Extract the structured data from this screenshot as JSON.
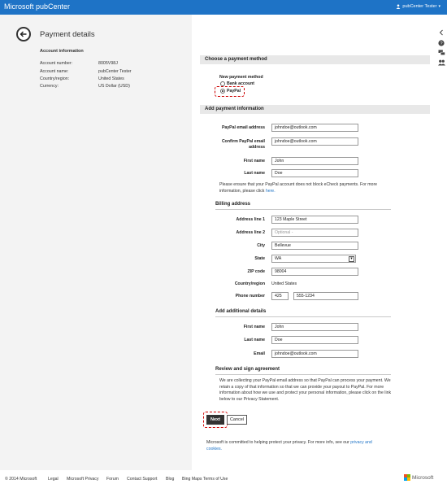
{
  "app": {
    "title": "Microsoft pubCenter",
    "user": "pubCenter Tester"
  },
  "page": {
    "title": "Payment details"
  },
  "account": {
    "heading": "Account information",
    "rows": [
      {
        "label": "Account number:",
        "value": "8005V98J"
      },
      {
        "label": "Account name:",
        "value": "pubCenter Tester"
      },
      {
        "label": "Country/region:",
        "value": "United States"
      },
      {
        "label": "Currency:",
        "value": "US Dollar (USD)"
      }
    ]
  },
  "payment_method": {
    "section_title": "Choose a payment method",
    "label": "New payment method",
    "options": [
      "Bank account",
      "PayPal"
    ],
    "selected": "PayPal"
  },
  "payment_info": {
    "section_title": "Add payment information",
    "paypal_email_label": "PayPal email address",
    "paypal_email_value": "johndoe@outlook.com",
    "confirm_email_label_1": "Confirm PayPal email",
    "confirm_email_label_2": "address",
    "confirm_email_value": "johndoe@outlook.com",
    "first_name_label": "First name",
    "first_name_value": "John",
    "last_name_label": "Last name",
    "last_name_value": "Doe",
    "note_line1": "Please ensure that your PayPal account does not block eCheck payments. For more",
    "note_line2": "information, please click",
    "note_link": "here."
  },
  "billing": {
    "heading": "Billing address",
    "line1_label": "Address line 1",
    "line1_value": "123 Maple Street",
    "line2_label": "Address line 2",
    "line2_placeholder": "Optional -",
    "city_label": "City",
    "city_value": "Bellevue",
    "state_label": "State",
    "state_value": "WA",
    "zip_label": "ZIP code",
    "zip_value": "98004",
    "country_label": "Country/region",
    "country_value": "United States",
    "phone_label": "Phone number",
    "phone_area": "425",
    "phone_number": "555-1234"
  },
  "additional": {
    "heading": "Add additional details",
    "first_name_label": "First name",
    "first_name_value": "John",
    "last_name_label": "Last name",
    "last_name_value": "Doe",
    "email_label": "Email",
    "email_value": "johndoe@outlook.com"
  },
  "agreement": {
    "heading": "Review and sign agreement",
    "lines": [
      "We are collecting your PayPal email address so that PayPal can process your payment. We",
      "retain a copy of that information so that we can provide your payout to PayPal. For more",
      "information about how we use and protect your personal information, please click on the link",
      "below to our Privacy Statement."
    ]
  },
  "actions": {
    "next": "Next",
    "cancel": "Cancel"
  },
  "privacy": {
    "line1": "Microsoft is committed to helping protect your privacy. For more info, see our",
    "link1": "privacy and",
    "link2": "cookies."
  },
  "footer": {
    "copyright": "© 2014 Microsoft",
    "links": [
      "Legal",
      "Microsoft Privacy",
      "Forum",
      "Contact Support",
      "Blog",
      "Bing Maps Terms of Use"
    ],
    "brand": "Microsoft"
  },
  "colors": {
    "accent": "#1e73c6",
    "highlight": "#cc0000",
    "section_bg": "#e8e8e8",
    "left_panel_bg": "#f3f3f3"
  },
  "icons": [
    "back-arrow-icon",
    "help-icon",
    "feedback-icon",
    "people-icon",
    "microsoft-logo-icon"
  ]
}
